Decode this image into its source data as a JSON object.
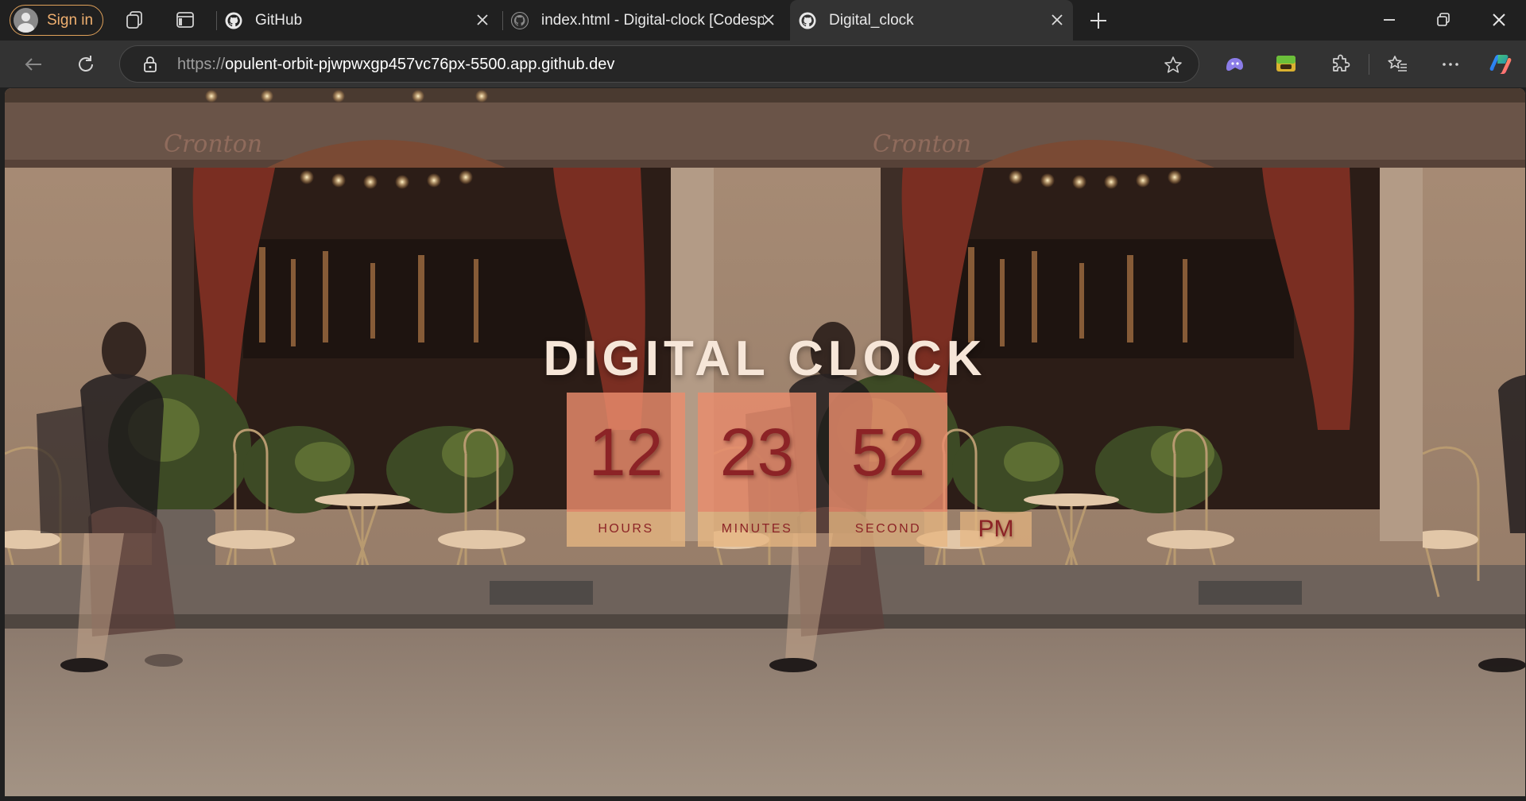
{
  "browser": {
    "signin_label": "Sign in",
    "tabs": [
      {
        "title": "GitHub",
        "icon": "github-icon"
      },
      {
        "title": "index.html - Digital-clock [Codespaces]",
        "icon": "github-icon"
      },
      {
        "title": "Digital_clock",
        "icon": "github-icon",
        "active": true
      }
    ],
    "address": {
      "scheme": "https://",
      "host": "opulent-orbit-pjwpwxgp457vc76px-5500.app.github.dev"
    }
  },
  "page": {
    "background": "cafe storefront photo (tiled)",
    "storefront_sign": "Cronton",
    "clock": {
      "title": "DIGITAL CLOCK",
      "hours": "12",
      "minutes": "23",
      "seconds": "52",
      "hours_label": "HOURS",
      "minutes_label": "MINUTES",
      "seconds_label": "SECOND",
      "period": "PM"
    }
  },
  "colors": {
    "clock_box": "#ea8c6c",
    "label_box": "#e7b682",
    "digit": "#8c2326",
    "title": "#f6e6d8",
    "signin_accent": "#e0a15a"
  }
}
